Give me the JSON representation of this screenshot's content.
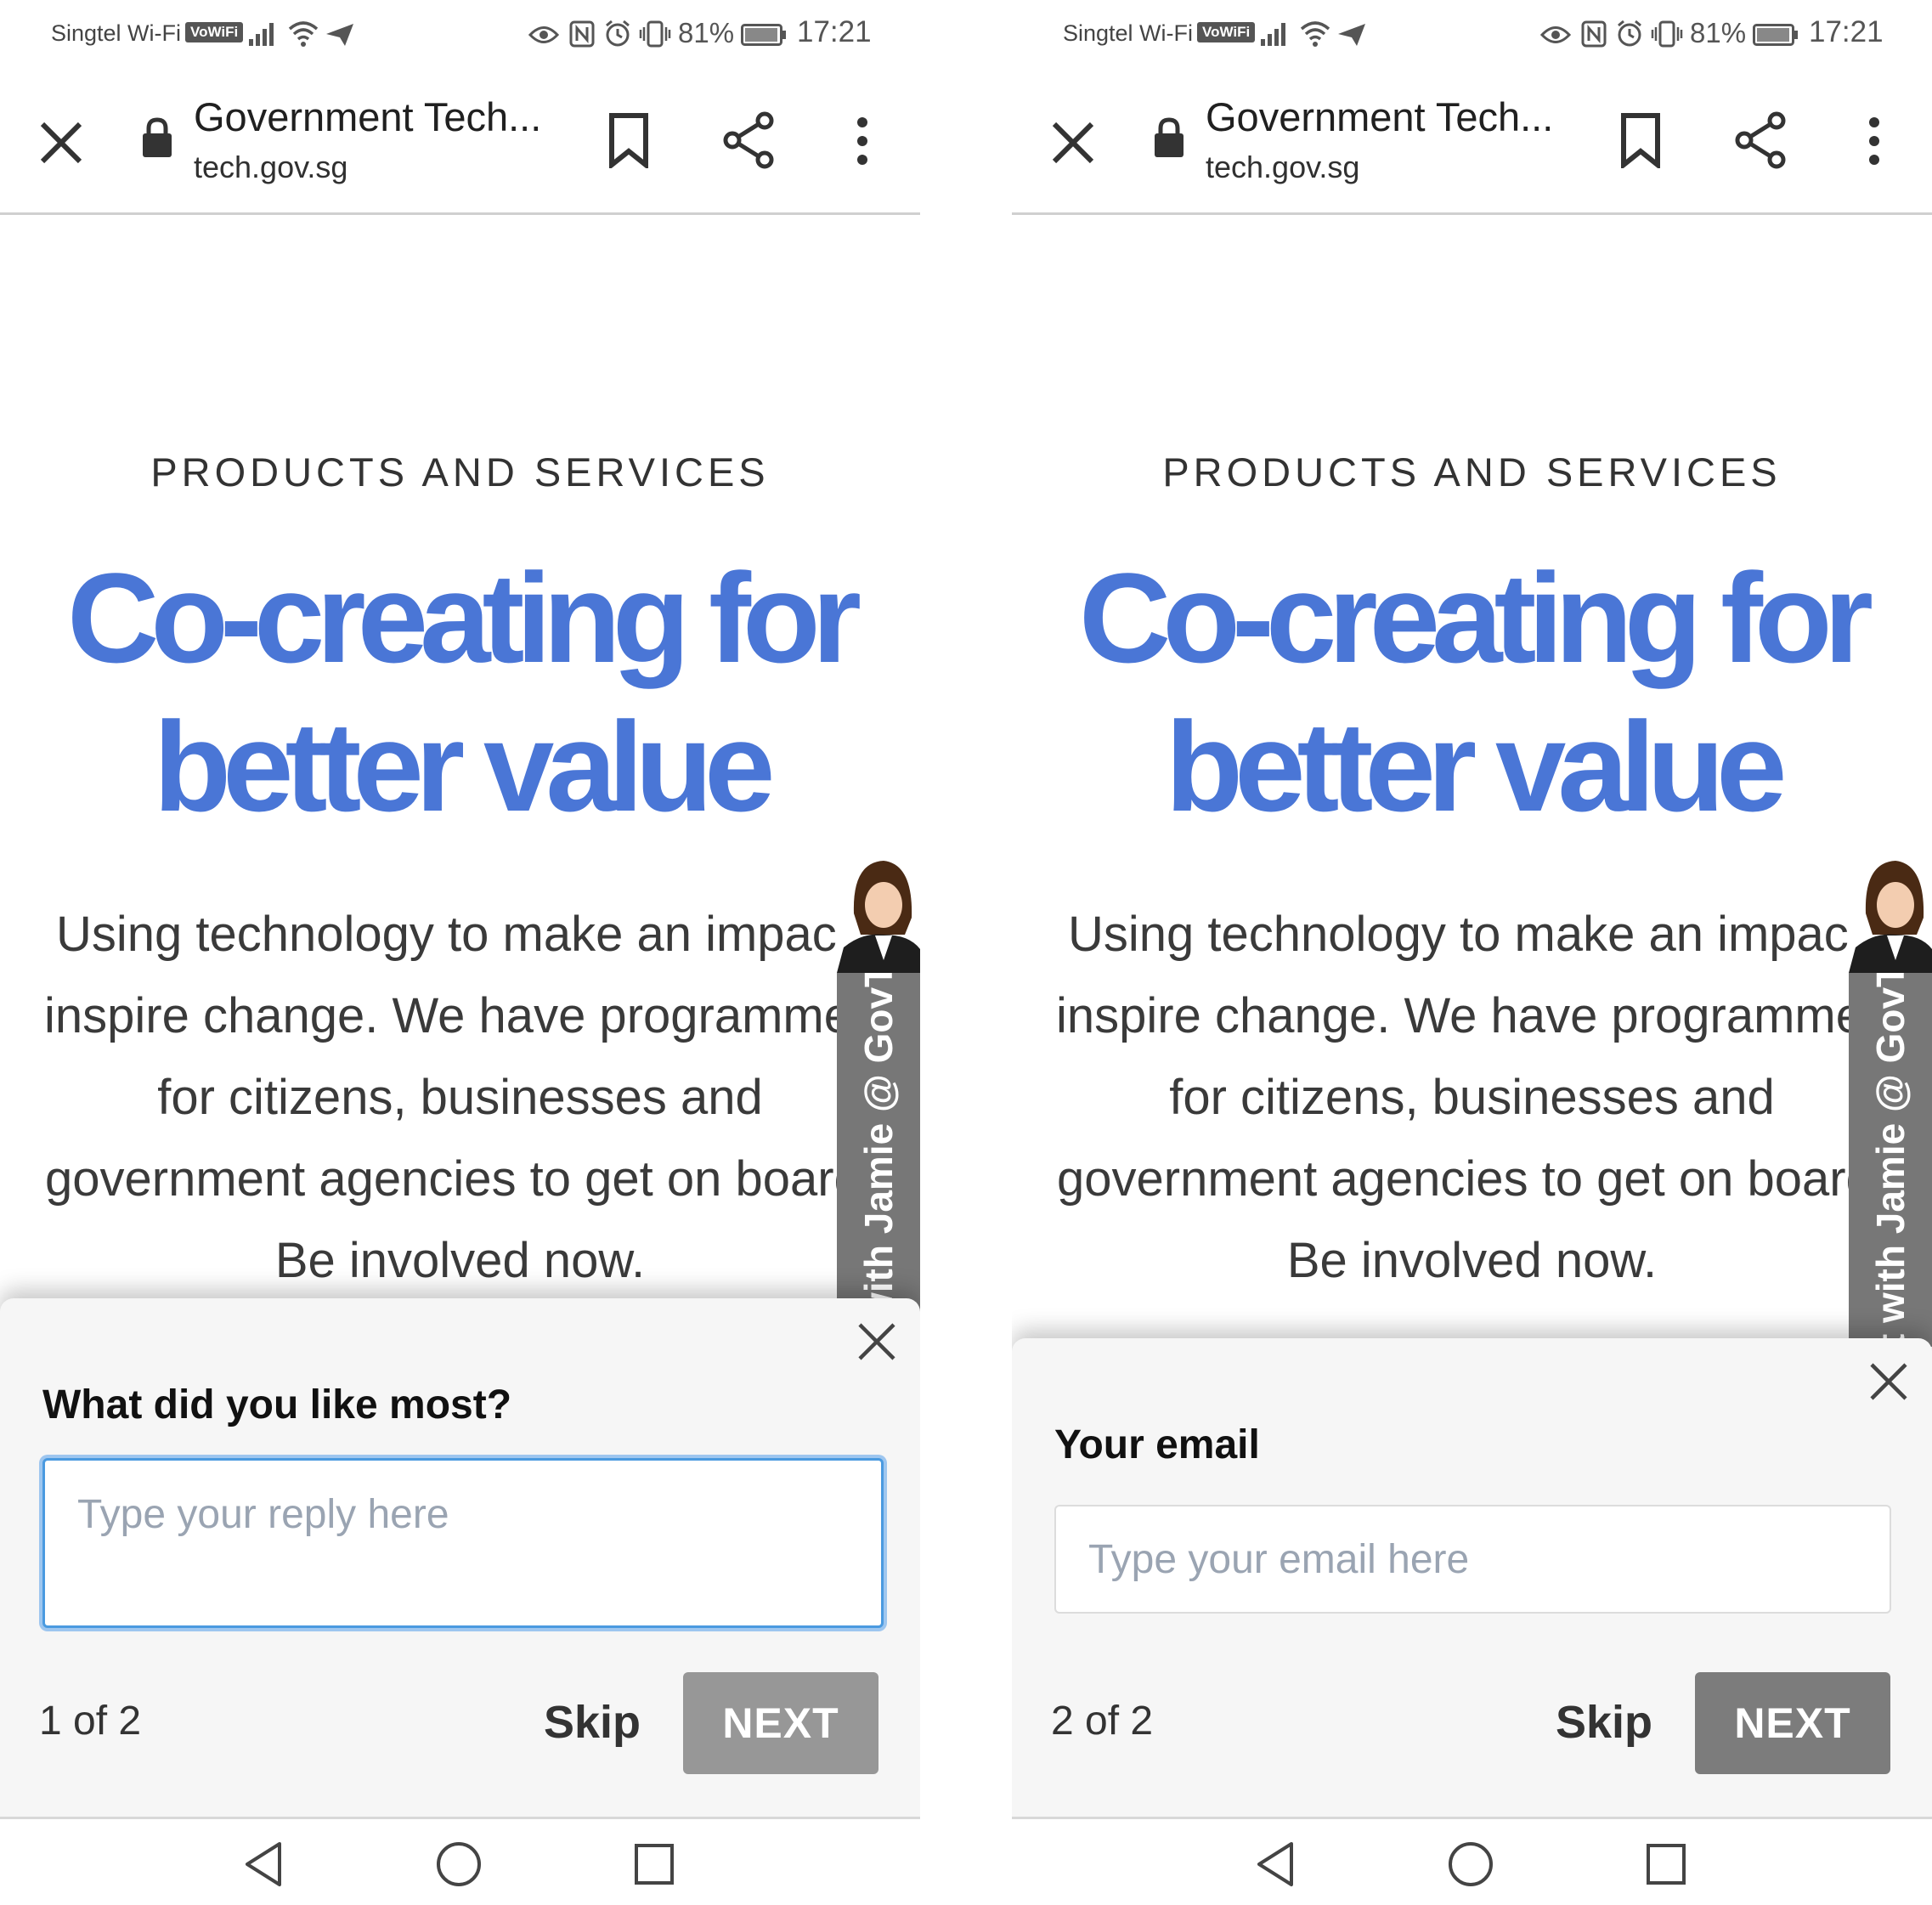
{
  "screens": [
    {
      "status": {
        "carrier": "Singtel Wi-Fi",
        "vowifi": "VoWiFi",
        "battery_pct": "81%",
        "time": "17:21"
      },
      "browser": {
        "title": "Government Tech...",
        "url": "tech.gov.sg"
      },
      "content": {
        "eyebrow": "PRODUCTS AND SERVICES",
        "headline_line1": "Co-creating for",
        "headline_line2": "better value",
        "body": "Using technology to make an impact, inspire change. We have programmes for citizens, businesses and government agencies to get on board. Be involved now."
      },
      "agent_tab": "Chat with Jamie @ GovTech",
      "survey": {
        "question": "What did you like most?",
        "placeholder": "Type your reply here",
        "step": "1 of 2",
        "skip": "Skip",
        "next": "NEXT"
      }
    },
    {
      "status": {
        "carrier": "Singtel Wi-Fi",
        "vowifi": "VoWiFi",
        "battery_pct": "81%",
        "time": "17:21"
      },
      "browser": {
        "title": "Government Tech...",
        "url": "tech.gov.sg"
      },
      "content": {
        "eyebrow": "PRODUCTS AND SERVICES",
        "headline_line1": "Co-creating for",
        "headline_line2": "better value",
        "body": "Using technology to make an impact, inspire change. We have programmes for citizens, businesses and government agencies to get on board. Be involved now."
      },
      "agent_tab": "Chat with Jamie @ GovTech",
      "survey": {
        "question": "Your email",
        "placeholder": "Type your email here",
        "step": "2 of 2",
        "skip": "Skip",
        "next": "NEXT"
      }
    }
  ],
  "colors": {
    "headline": "#4a76d6",
    "focus_border": "#4a9ae0",
    "next_disabled": "#979797",
    "next_enabled": "#7c7c7c"
  },
  "icons": [
    "signal-icon",
    "wifi-icon",
    "send-icon",
    "eye-icon",
    "nfc-icon",
    "alarm-icon",
    "vibrate-icon",
    "battery-icon",
    "close-icon",
    "lock-icon",
    "bookmark-icon",
    "share-icon",
    "more-vert-icon",
    "back-icon",
    "home-icon",
    "recents-icon"
  ]
}
